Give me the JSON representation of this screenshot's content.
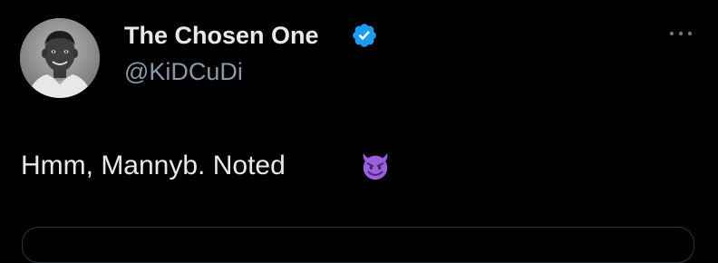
{
  "tweet": {
    "display_name": "The Chosen One",
    "handle": "@KiDCuDi",
    "text": "Hmm, Mannyb.  Noted",
    "emoji": "smiling-face-with-horns"
  },
  "icons": {
    "verified": "verified-badge-icon",
    "more": "more-options-icon"
  },
  "colors": {
    "background": "#000000",
    "text_primary": "#e7e9ea",
    "text_secondary": "#8b98a5",
    "verified_blue": "#1d9bf0",
    "emoji_purple": "#9b5fe0",
    "border": "#2f3336"
  }
}
